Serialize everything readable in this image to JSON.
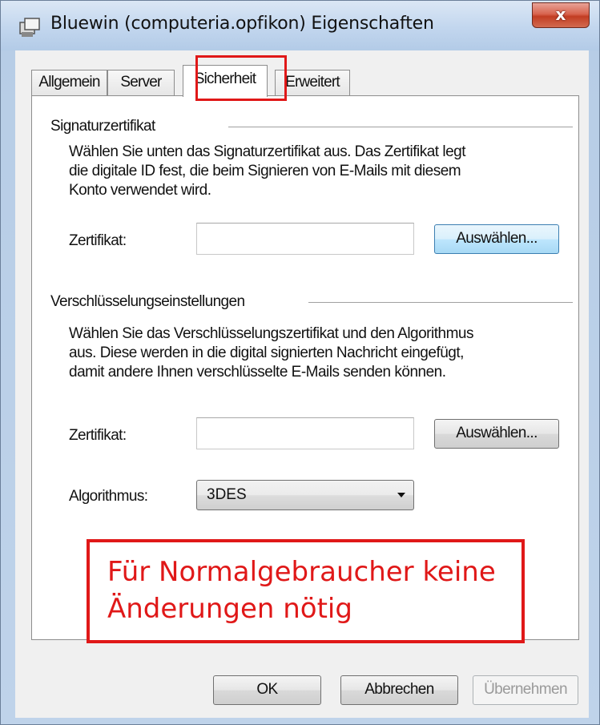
{
  "window": {
    "title": "Bluewin (computeria.opfikon) Eigenschaften",
    "close_label": "x"
  },
  "tabs": [
    {
      "label": "Allgemein",
      "active": false
    },
    {
      "label": "Server",
      "active": false
    },
    {
      "label": "Sicherheit",
      "active": true
    },
    {
      "label": "Erweitert",
      "active": false
    }
  ],
  "signing": {
    "group_label": "Signaturzertifikat",
    "description_lines": [
      "Wählen Sie unten das Signaturzertifikat aus. Das Zertifikat legt",
      "die digitale ID fest, die beim Signieren von E-Mails mit diesem",
      "Konto verwendet wird."
    ],
    "cert_label": "Zertifikat:",
    "cert_value": "",
    "choose_button": "Auswählen..."
  },
  "encryption": {
    "group_label": "Verschlüsselungseinstellungen",
    "description_lines": [
      "Wählen Sie das Verschlüsselungszertifikat und den Algorithmus",
      "aus. Diese werden in die digital signierten Nachricht eingefügt,",
      "damit andere Ihnen verschlüsselte E-Mails senden können."
    ],
    "cert_label": "Zertifikat:",
    "cert_value": "",
    "choose_button": "Auswählen...",
    "algorithm_label": "Algorithmus:",
    "algorithm_value": "3DES"
  },
  "annotation": {
    "lines": [
      "Für Normalgebraucher keine",
      "Änderungen nötig"
    ],
    "color": "#e01818"
  },
  "footer": {
    "ok": "OK",
    "cancel": "Abbrechen",
    "apply": "Übernehmen"
  }
}
